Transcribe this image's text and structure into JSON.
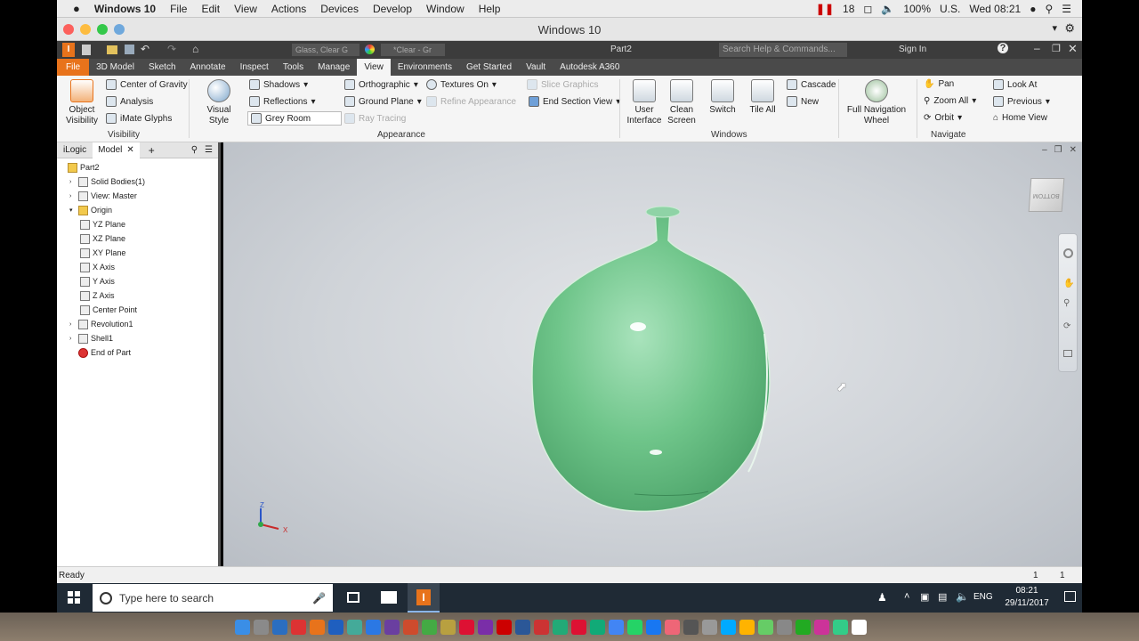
{
  "mac_menubar": {
    "apple": "",
    "app_name": "Windows 10",
    "menus": [
      "File",
      "Edit",
      "View",
      "Actions",
      "Devices",
      "Develop",
      "Window",
      "Help"
    ],
    "status_count": "18",
    "battery": "100%",
    "input_source": "U.S.",
    "clock": "Wed 08:21"
  },
  "vm_window": {
    "title": "Windows 10"
  },
  "inventor": {
    "doc_title": "Part2",
    "material_dropdown": "Glass, Clear G",
    "appearance_dropdown": "*Clear - Gr",
    "search_placeholder": "Search Help & Commands...",
    "sign_in": "Sign In",
    "tabs": [
      "File",
      "3D Model",
      "Sketch",
      "Annotate",
      "Inspect",
      "Tools",
      "Manage",
      "View",
      "Environments",
      "Get Started",
      "Vault",
      "Autodesk A360"
    ],
    "active_tab": "View"
  },
  "ribbon": {
    "visibility": {
      "object_visibility": "Object Visibility",
      "center_of_gravity": "Center of Gravity",
      "analysis": "Analysis",
      "imate_glyphs": "iMate Glyphs",
      "label": "Visibility"
    },
    "appearance": {
      "visual_style": "Visual Style",
      "shadows": "Shadows",
      "reflections": "Reflections",
      "grey_room": "Grey Room",
      "orthographic": "Orthographic",
      "ground_plane": "Ground Plane",
      "ray_tracing": "Ray Tracing",
      "textures_on": "Textures On",
      "refine_appearance": "Refine Appearance",
      "slice_graphics": "Slice Graphics",
      "end_section_view": "End Section View",
      "label": "Appearance"
    },
    "windows": {
      "user_interface": "User Interface",
      "clean_screen": "Clean Screen",
      "switch": "Switch",
      "tile_all": "Tile All",
      "cascade": "Cascade",
      "new": "New",
      "label": "Windows"
    },
    "navigate": {
      "full_navigation_wheel": "Full Navigation Wheel",
      "pan": "Pan",
      "zoom_all": "Zoom All",
      "orbit": "Orbit",
      "look_at": "Look At",
      "previous": "Previous",
      "home_view": "Home View",
      "label": "Navigate"
    }
  },
  "browser": {
    "tabs": [
      "iLogic",
      "Model"
    ],
    "tree": [
      {
        "label": "Part2",
        "level": 0
      },
      {
        "label": "Solid Bodies(1)",
        "level": 1
      },
      {
        "label": "View: Master",
        "level": 1
      },
      {
        "label": "Origin",
        "level": 1
      },
      {
        "label": "YZ Plane",
        "level": 2
      },
      {
        "label": "XZ Plane",
        "level": 2
      },
      {
        "label": "XY Plane",
        "level": 2
      },
      {
        "label": "X Axis",
        "level": 2
      },
      {
        "label": "Y Axis",
        "level": 2
      },
      {
        "label": "Z Axis",
        "level": 2
      },
      {
        "label": "Center Point",
        "level": 2
      },
      {
        "label": "Revolution1",
        "level": 1
      },
      {
        "label": "Shell1",
        "level": 1
      },
      {
        "label": "End of Part",
        "level": 1
      }
    ]
  },
  "viewport": {
    "viewcube_label": "BOTTOM",
    "triad": {
      "z": "Z",
      "x": "X"
    },
    "bottle_color": "#6fc58a"
  },
  "status": {
    "text": "Ready",
    "count_a": "1",
    "count_b": "1"
  },
  "taskbar": {
    "search_placeholder": "Type here to search",
    "language": "ENG",
    "time": "08:21",
    "date": "29/11/2017"
  }
}
